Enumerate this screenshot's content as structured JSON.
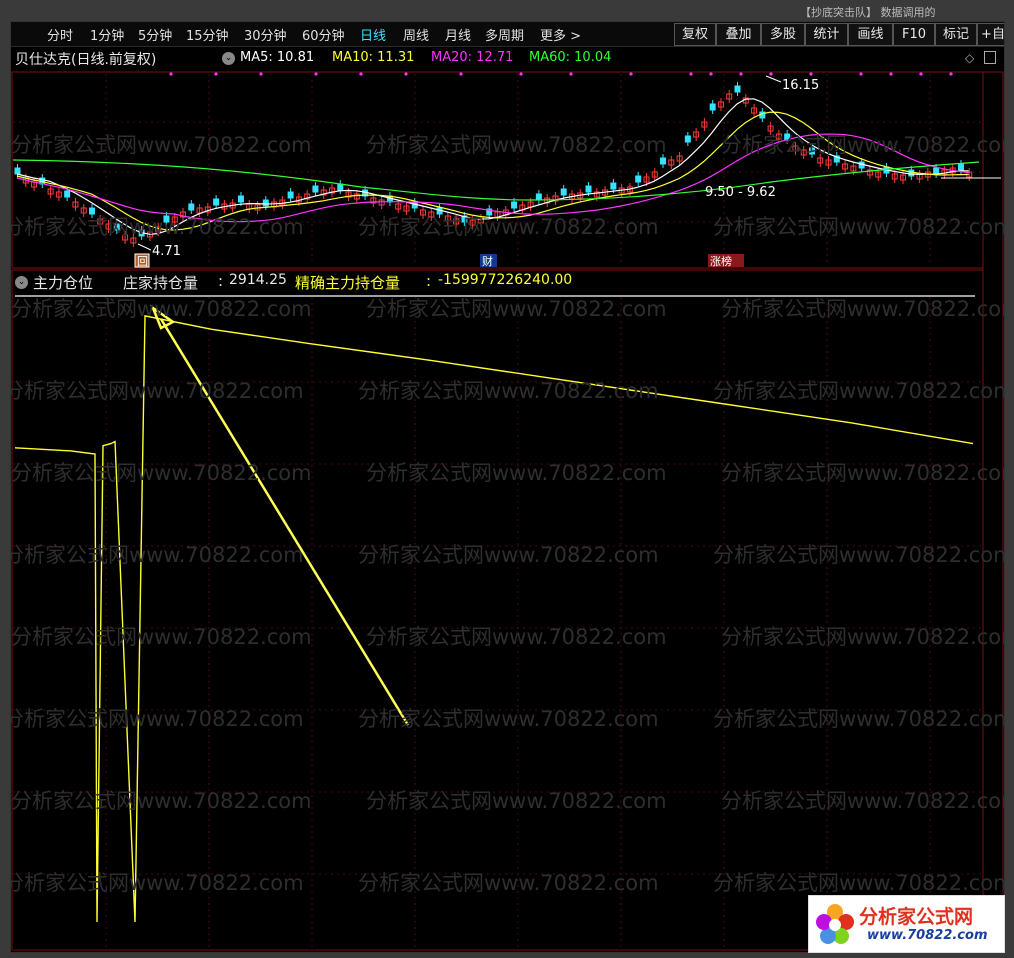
{
  "toolbar": {
    "periods": [
      "分时",
      "1分钟",
      "5分钟",
      "15分钟",
      "30分钟",
      "60分钟",
      "日线",
      "周线",
      "月线",
      "多周期",
      "更多 >"
    ],
    "active_period": "日线",
    "buttons": [
      "复权",
      "叠加",
      "多股",
      "统计",
      "画线",
      "F10",
      "标记",
      "+自"
    ]
  },
  "top_notice": "【抄底突击队】 数据调用的",
  "main_panel": {
    "title": "贝仕达克(日线.前复权)",
    "indicators": [
      {
        "name": "MA5",
        "value": "10.81",
        "color": "#ffffff"
      },
      {
        "name": "MA10",
        "value": "11.31",
        "color": "#ffff33"
      },
      {
        "name": "MA20",
        "value": "12.71",
        "color": "#ff33ff"
      },
      {
        "name": "MA60",
        "value": "10.04",
        "color": "#33ff33"
      }
    ],
    "annotations": {
      "high": "16.15",
      "low": "4.71",
      "range": "9.50 - 9.62",
      "tag_return": "回",
      "tag_finance": "财",
      "tag_limit": "涨榜"
    },
    "bull_color": "#ff3b3b",
    "bear_color": "#35e2ff"
  },
  "sub_panel": {
    "name": "主力仓位",
    "line1_name": "庄家持仓量",
    "line1_value": "2914.25",
    "line2_name": "精确主力持仓量",
    "line2_value": "-159977226240.00",
    "line_color": "#ffff33"
  },
  "watermark": "分析家公式网www.70822.com",
  "logo": {
    "title": "分析家公式网",
    "url": "www.70822.com"
  },
  "chart_data": {
    "type": "line",
    "title": "",
    "series": [
      {
        "name": "庄家持仓量",
        "values": [
          2280,
          2265,
          2250,
          0,
          2290,
          2300,
          2310,
          0,
          2914,
          2850,
          2780,
          2700,
          2600,
          2500,
          2400,
          2300
        ]
      }
    ],
    "ylim": [
      0,
      3000
    ]
  }
}
